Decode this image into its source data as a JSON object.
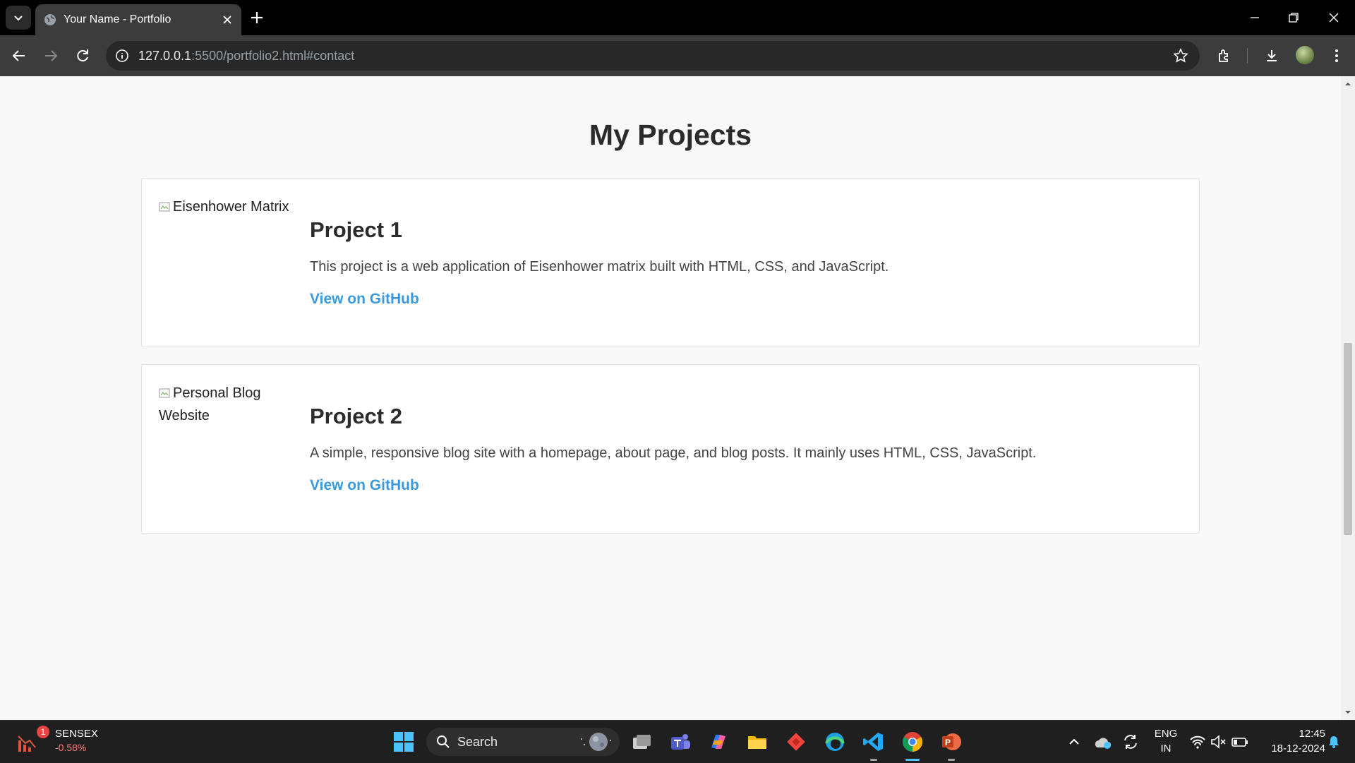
{
  "browser": {
    "tab_title": "Your Name - Portfolio",
    "url_host": "127.0.0.1",
    "url_path": ":5500/portfolio2.html#contact"
  },
  "page": {
    "section_title": "My Projects",
    "projects": [
      {
        "image_alt": "Eisenhower Matrix",
        "title": "Project 1",
        "description": "This project is a web application of Eisenhower matrix built with HTML, CSS, and JavaScript.",
        "link_label": "View on GitHub"
      },
      {
        "image_alt": "Personal Blog Website",
        "title": "Project 2",
        "description": "A simple, responsive blog site with a homepage, about page, and blog posts. It mainly uses HTML, CSS, JavaScript.",
        "link_label": "View on GitHub"
      }
    ],
    "link_color": "#3a9ae0"
  },
  "taskbar": {
    "widget_name": "SENSEX",
    "widget_value": "-0.58%",
    "widget_badge": "1",
    "search_label": "Search",
    "language_line1": "ENG",
    "language_line2": "IN",
    "time": "12:45",
    "date": "18-12-2024",
    "apps": [
      "task-view-icon",
      "teams-icon",
      "copilot-icon",
      "file-explorer-icon",
      "anydesk-icon",
      "edge-icon",
      "vscode-icon",
      "chrome-icon",
      "powerpoint-icon"
    ]
  }
}
